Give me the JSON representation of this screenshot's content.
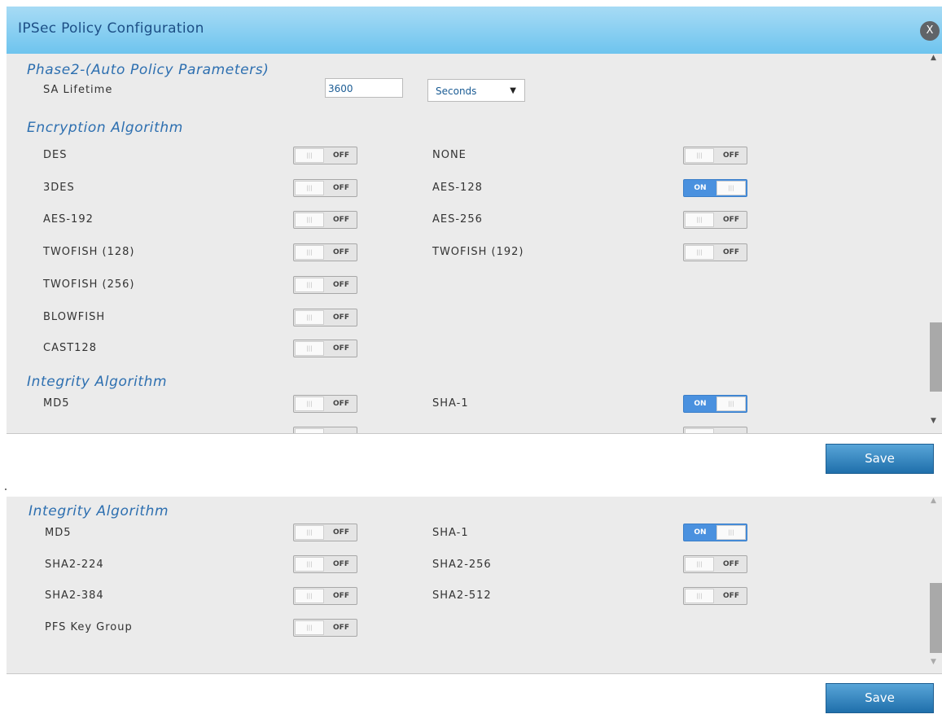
{
  "dialog": {
    "title": "IPSec Policy Configuration",
    "close_label": "X"
  },
  "panel1": {
    "phase2_title": "Phase2-(Auto Policy Parameters)",
    "sa_lifetime": {
      "label": "SA Lifetime",
      "value": "3600",
      "unit": "Seconds"
    },
    "encryption_title": "Encryption Algorithm",
    "encryption": {
      "des": {
        "label": "DES",
        "state": "OFF"
      },
      "none": {
        "label": "NONE",
        "state": "OFF"
      },
      "des3": {
        "label": "3DES",
        "state": "OFF"
      },
      "aes128": {
        "label": "AES-128",
        "state": "ON"
      },
      "aes192": {
        "label": "AES-192",
        "state": "OFF"
      },
      "aes256": {
        "label": "AES-256",
        "state": "OFF"
      },
      "twofish128": {
        "label": "TWOFISH (128)",
        "state": "OFF"
      },
      "twofish192": {
        "label": "TWOFISH (192)",
        "state": "OFF"
      },
      "twofish256": {
        "label": "TWOFISH (256)",
        "state": "OFF"
      },
      "blowfish": {
        "label": "BLOWFISH",
        "state": "OFF"
      },
      "cast128": {
        "label": "CAST128",
        "state": "OFF"
      }
    },
    "integrity_title": "Integrity Algorithm",
    "integrity": {
      "md5": {
        "label": "MD5",
        "state": "OFF"
      },
      "sha1": {
        "label": "SHA-1",
        "state": "ON"
      }
    }
  },
  "panel2": {
    "integrity_title": "Integrity Algorithm",
    "integrity": {
      "md5": {
        "label": "MD5",
        "state": "OFF"
      },
      "sha1": {
        "label": "SHA-1",
        "state": "ON"
      },
      "sha2_224": {
        "label": "SHA2-224",
        "state": "OFF"
      },
      "sha2_256": {
        "label": "SHA2-256",
        "state": "OFF"
      },
      "sha2_384": {
        "label": "SHA2-384",
        "state": "OFF"
      },
      "sha2_512": {
        "label": "SHA2-512",
        "state": "OFF"
      }
    },
    "pfs": {
      "label": "PFS Key Group",
      "state": "OFF"
    }
  },
  "buttons": {
    "save_label": "Save"
  },
  "toggle": {
    "knob_glyph": "|||"
  },
  "colors": {
    "titlebar": "#6ec4ee",
    "accent": "#2d6fb0",
    "toggle_on": "#4a91df",
    "save": "#1f6fab"
  }
}
